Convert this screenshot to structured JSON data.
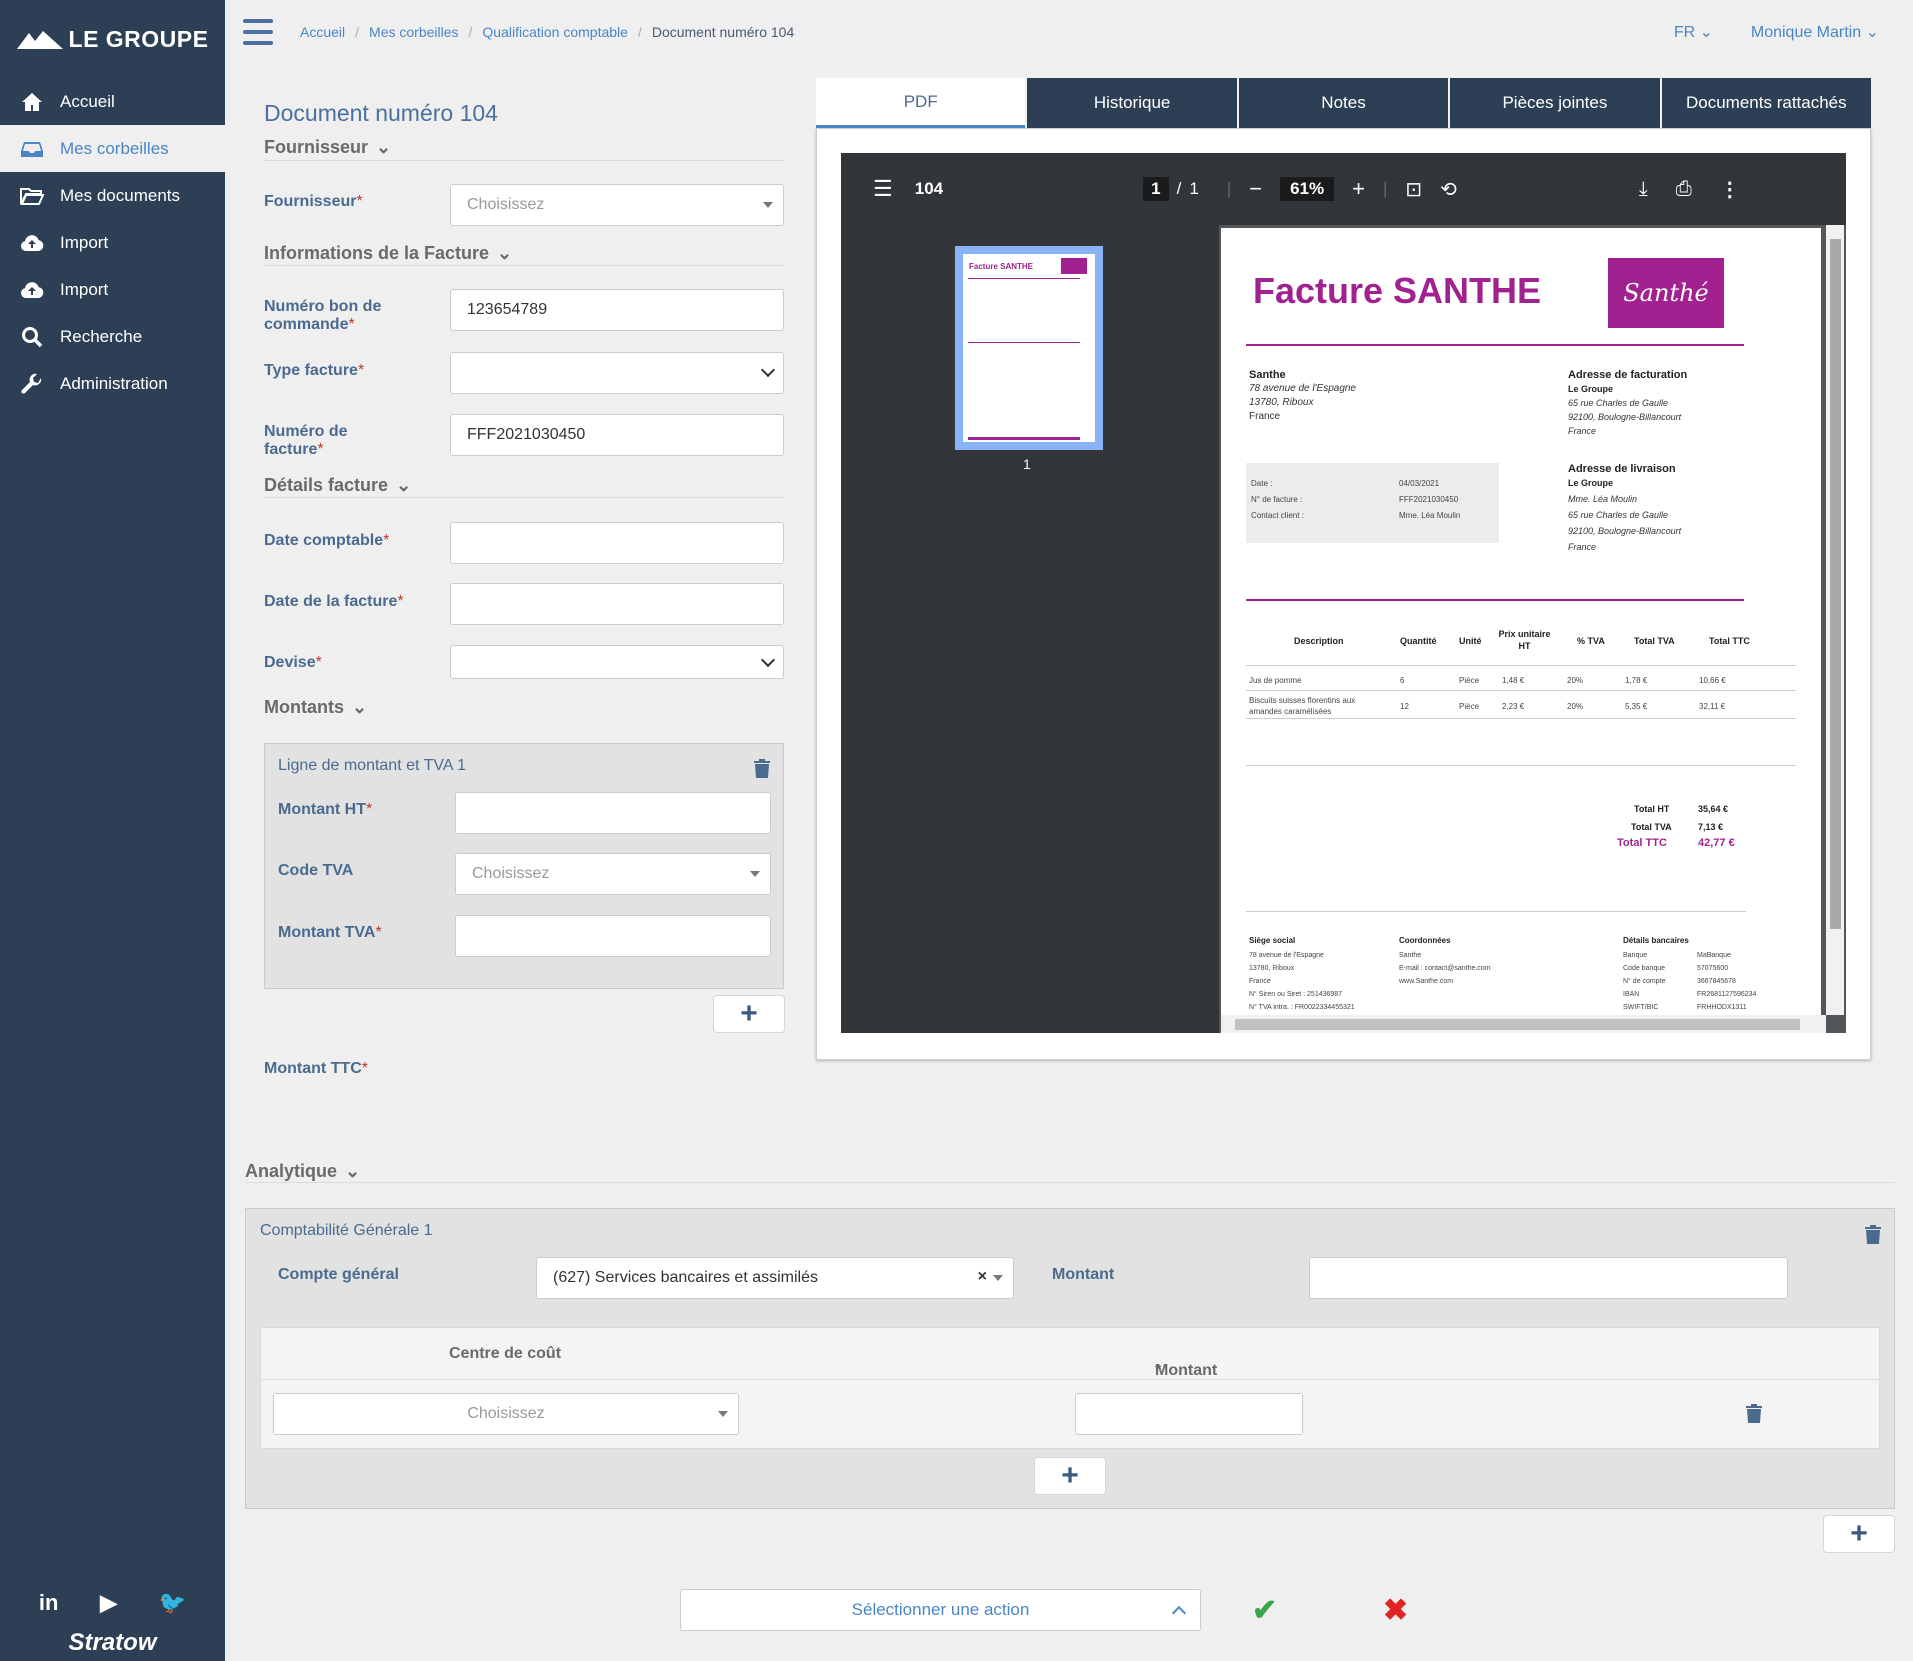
{
  "sidebar": {
    "logo": "LE GROUPE",
    "items": [
      {
        "label": "Accueil",
        "icon": "home-icon"
      },
      {
        "label": "Mes corbeilles",
        "icon": "inbox-icon"
      },
      {
        "label": "Mes documents",
        "icon": "folder-open-icon"
      },
      {
        "label": "Import",
        "icon": "cloud-upload-icon"
      },
      {
        "label": "Import",
        "icon": "cloud-upload-icon"
      },
      {
        "label": "Recherche",
        "icon": "search-icon"
      },
      {
        "label": "Administration",
        "icon": "wrench-icon"
      }
    ],
    "social": [
      "in",
      "▶",
      "🐦"
    ],
    "brand": "Stratow"
  },
  "topbar": {
    "breadcrumb": [
      "Accueil",
      "Mes corbeilles",
      "Qualification comptable",
      "Document numéro 104"
    ],
    "lang": "FR",
    "user": "Monique Martin"
  },
  "form": {
    "title": "Document numéro 104",
    "sections": {
      "fournisseur": "Fournisseur",
      "facture": "Informations de la Facture",
      "details": "Détails facture",
      "montants": "Montants"
    },
    "fields": {
      "fournisseur_label": "Fournisseur",
      "fournisseur_placeholder": "Choisissez",
      "bon_commande_label": "Numéro bon de commande",
      "bon_commande_value": "123654789",
      "type_facture_label": "Type facture",
      "numero_facture_label": "Numéro de facture",
      "numero_facture_value": "FFF2021030450",
      "date_comptable_label": "Date comptable",
      "date_facture_label": "Date de la facture",
      "devise_label": "Devise",
      "montant_ttc_label": "Montant TTC"
    },
    "amount_line": {
      "title": "Ligne de montant et TVA 1",
      "montant_ht_label": "Montant HT",
      "code_tva_label": "Code TVA",
      "code_tva_placeholder": "Choisissez",
      "montant_tva_label": "Montant TVA"
    },
    "add_symbol": "+"
  },
  "tabs": [
    "PDF",
    "Historique",
    "Notes",
    "Pièces jointes",
    "Documents rattachés"
  ],
  "pdf_viewer": {
    "doc_name": "104",
    "page_current": "1",
    "page_sep": "/",
    "page_total": "1",
    "zoom": "61%",
    "thumb_label": "1"
  },
  "invoice": {
    "title": "Facture SANTHE",
    "logo_text": "Santhé",
    "seller_name": "Santhe",
    "seller_address": [
      "78 avenue de l'Espagne",
      "13780, Riboux",
      "France"
    ],
    "billing_title": "Adresse de facturation",
    "billing_lines": [
      "Le Groupe",
      "65 rue Charles de Gaulle",
      "92100, Boulogne-Billancourt",
      "France"
    ],
    "shipping_title": "Adresse de livraison",
    "shipping_lines": [
      "Le Groupe",
      "Mme. Léa Moulin",
      "65 rue Charles de Gaulle",
      "92100, Boulogne-Billancourt",
      "France"
    ],
    "info_labels": [
      "Date :",
      "N° de facture :",
      "Contact client :"
    ],
    "info_values": [
      "04/03/2021",
      "FFF2021030450",
      "Mme. Léa Moulin"
    ],
    "table_headers": [
      "Description",
      "Quantité",
      "Unité",
      "Prix unitaire HT",
      "% TVA",
      "Total TVA",
      "Total TTC"
    ],
    "rows": [
      [
        "Jus de pomme",
        "6",
        "Pièce",
        "1,48 €",
        "20%",
        "1,78 €",
        "10,66 €"
      ],
      [
        "Biscuits suisses florentins aux amandes caramélisées",
        "12",
        "Pièce",
        "2,23 €",
        "20%",
        "5,35 €",
        "32,11 €"
      ]
    ],
    "totals": [
      {
        "label": "Total HT",
        "value": "35,64 €"
      },
      {
        "label": "Total TVA",
        "value": "7,13 €"
      },
      {
        "label": "Total TTC",
        "value": "42,77 €"
      }
    ],
    "footer": {
      "siege_title": "Siège social",
      "siege_lines": [
        "78 avenue de l'Espagne",
        "13780, Riboux",
        "France",
        "N° Siren ou Siret : 251436987",
        "N° TVA intra. : FR0022334455321"
      ],
      "coord_title": "Coordonnées",
      "coord_lines": [
        "Santhe",
        "E-mail : contact@santhe.com",
        "www.Santhe.com"
      ],
      "bank_title": "Détails bancaires",
      "bank_labels": [
        "Banque",
        "Code banque",
        "N° de compte",
        "IBAN",
        "SWIFT/BIC"
      ],
      "bank_values": [
        "MaBanque",
        "57075600",
        "3667845678",
        "FR2681127596234",
        "FRHHODX1311"
      ]
    }
  },
  "analytique": {
    "section": "Analytique",
    "box_title": "Comptabilité Générale 1",
    "compte_label": "Compte général",
    "compte_value": "(627) Services bancaires et assimilés",
    "clear_symbol": "×",
    "montant_label": "Montant",
    "cc_header": "Centre de coût",
    "cc_montant_header": "Montant",
    "cc_placeholder": "Choisissez"
  },
  "actions": {
    "select_label": "Sélectionner une action",
    "ok_symbol": "✔",
    "cancel_symbol": "✖"
  },
  "colors": {
    "sidebar": "#2d3f55",
    "accent": "#4a86c6",
    "invoice_brand": "#a0218f",
    "ok": "#3aa64a",
    "cancel": "#e02424"
  }
}
